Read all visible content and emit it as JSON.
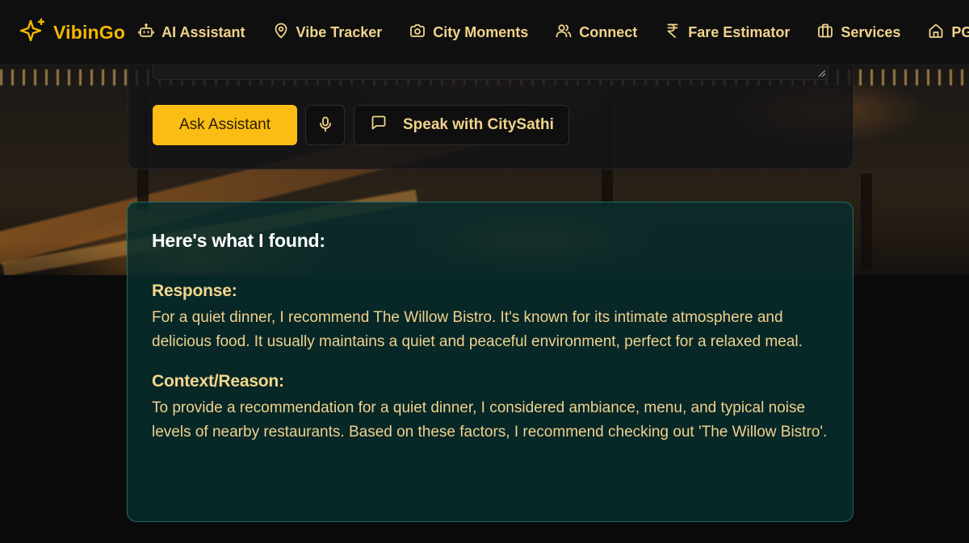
{
  "brand": {
    "name": "VibinGo",
    "icon": "sparkles-icon",
    "accent": "#f5b800"
  },
  "nav": {
    "items": [
      {
        "label": "AI Assistant",
        "icon": "bot-icon"
      },
      {
        "label": "Vibe Tracker",
        "icon": "map-pin-icon"
      },
      {
        "label": "City Moments",
        "icon": "camera-icon"
      },
      {
        "label": "Connect",
        "icon": "users-icon"
      },
      {
        "label": "Fare Estimator",
        "icon": "rupee-icon"
      },
      {
        "label": "Services",
        "icon": "briefcase-icon"
      },
      {
        "label": "PG",
        "icon": "home-icon"
      }
    ]
  },
  "assistant": {
    "query_value": "",
    "ask_button_label": "Ask Assistant",
    "mic_icon": "mic-icon",
    "speak_button_label": "Speak with CitySathi",
    "speak_icon": "chat-bubble-icon"
  },
  "result": {
    "title": "Here's what I found:",
    "response_heading": "Response:",
    "response_text": "For a quiet dinner, I recommend The Willow Bistro. It's known for its intimate atmosphere and delicious food. It usually maintains a quiet and peaceful environment, perfect for a relaxed meal.",
    "context_heading": "Context/Reason:",
    "context_text": "To provide a recommendation for a quiet dinner, I considered ambiance, menu, and typical noise levels of nearby restaurants. Based on these factors, I recommend checking out 'The Willow Bistro'."
  },
  "colors": {
    "primary_button": "#fbbd14",
    "nav_text": "#f0d48a",
    "card_border": "#1d6b62",
    "card_bg": "#082c2c"
  }
}
